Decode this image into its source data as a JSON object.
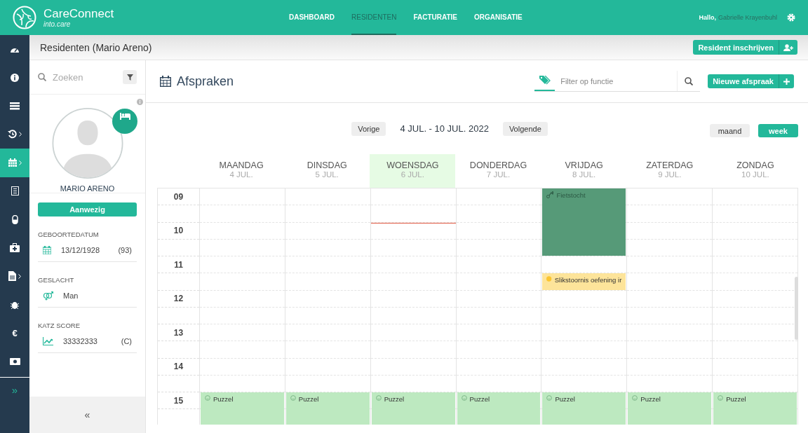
{
  "app": {
    "name": "CareConnect",
    "subtitle": "into.care"
  },
  "nav": [
    {
      "label": "DASHBOARD",
      "selected": false
    },
    {
      "label": "RESIDENTEN",
      "selected": true
    },
    {
      "label": "FACTURATIE",
      "selected": false
    },
    {
      "label": "ORGANISATIE",
      "selected": false
    }
  ],
  "user": {
    "greeting": "Hallo,",
    "name": "Gabrielle Krayenbuhl"
  },
  "side_menu": [
    {
      "kind": "dashboard",
      "submenu": false,
      "selected": false
    },
    {
      "kind": "info",
      "submenu": false,
      "selected": false
    },
    {
      "kind": "bars",
      "submenu": false,
      "selected": false
    },
    {
      "kind": "history",
      "submenu": true,
      "selected": false
    },
    {
      "kind": "calendar",
      "submenu": true,
      "selected": true
    },
    {
      "kind": "checklist",
      "submenu": false,
      "selected": false
    },
    {
      "kind": "pill",
      "submenu": false,
      "selected": false
    },
    {
      "kind": "medkit",
      "submenu": false,
      "selected": false
    },
    {
      "kind": "document",
      "submenu": true,
      "selected": false
    },
    {
      "kind": "bug",
      "submenu": false,
      "selected": false
    },
    {
      "kind": "glyph",
      "glyph": "€",
      "submenu": false,
      "selected": false
    },
    {
      "kind": "money",
      "submenu": false,
      "selected": false
    }
  ],
  "side_expand": "»",
  "page_title": "Residenten (Mario Areno)",
  "enroll_button": "Resident inschrijven",
  "resident": {
    "search_placeholder": "Zoeken",
    "name": "MARIO ARENO",
    "status": "Aanwezig",
    "fields": [
      {
        "kind": "calendar",
        "label": "GEBOORTEDATUM",
        "value": "13/12/1928",
        "extra": "(93)"
      },
      {
        "kind": "gender",
        "label": "GESLACHT",
        "value": "Man"
      },
      {
        "kind": "chart",
        "label": "KATZ SCORE",
        "value": "33332333",
        "extra": "(C)"
      }
    ],
    "collapse": "«"
  },
  "appointments": {
    "title": "Afspraken",
    "filter_placeholder": "Filter op functie",
    "new_button": "Nieuwe afspraak",
    "prev": "Vorige",
    "range": "4 JUL. - 10 JUL. 2022",
    "next": "Volgende",
    "views": [
      {
        "label": "maand",
        "selected": false
      },
      {
        "label": "week",
        "selected": true
      }
    ],
    "hours": [
      "09",
      "10",
      "11",
      "12",
      "13",
      "14",
      "15"
    ],
    "days": [
      {
        "name": "MAANDAG",
        "date": "4 JUL.",
        "today": false,
        "events": [
          {
            "title": "Puzzel",
            "kind": "smile",
            "color": "#bde9c0"
          }
        ]
      },
      {
        "name": "DINSDAG",
        "date": "5 JUL.",
        "today": false,
        "events": [
          {
            "title": "Puzzel",
            "kind": "smile",
            "color": "#bde9c0"
          }
        ]
      },
      {
        "name": "WOENSDAG",
        "date": "6 JUL.",
        "today": true,
        "events": [
          {
            "title": "Puzzel",
            "kind": "smile",
            "color": "#bde9c0"
          }
        ]
      },
      {
        "name": "DONDERDAG",
        "date": "7 JUL.",
        "today": false,
        "events": [
          {
            "title": "Puzzel",
            "kind": "smile",
            "color": "#bde9c0"
          }
        ]
      },
      {
        "name": "VRIJDAG",
        "date": "8 JUL.",
        "today": false,
        "events": [
          {
            "title": "Fietstocht",
            "kind": "bike",
            "color": "#569a78"
          },
          {
            "title": "Slikstoornis oefening ir",
            "kind": "dot",
            "color": "#fde49a"
          },
          {
            "title": "Puzzel",
            "kind": "smile",
            "color": "#bde9c0"
          }
        ]
      },
      {
        "name": "ZATERDAG",
        "date": "9 JUL.",
        "today": false,
        "events": [
          {
            "title": "Puzzel",
            "kind": "smile",
            "color": "#bde9c0"
          }
        ]
      },
      {
        "name": "ZONDAG",
        "date": "10 JUL.",
        "today": false,
        "events": [
          {
            "title": "Puzzel",
            "kind": "smile",
            "color": "#bde9c0"
          }
        ]
      }
    ]
  }
}
